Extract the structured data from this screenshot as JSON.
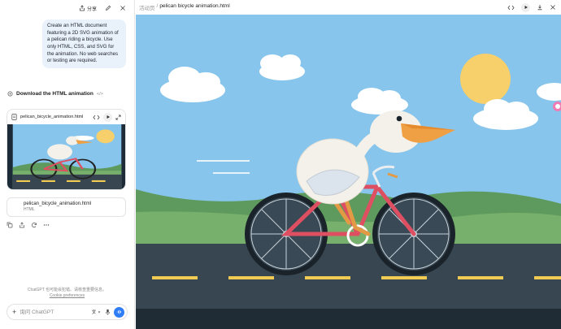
{
  "chat": {
    "topbar": {
      "share_label": "分享"
    },
    "user_message": "Create an HTML document featuring a 2D SVG animation of a pelican riding a bicycle. Use only HTML, CSS, and SVG for the animation. No web searches or testing are required.",
    "download_label": "Download the HTML animation",
    "code_tag": "</>",
    "preview_card": {
      "filename": "pelican_bicycle_animation.html"
    },
    "file_card": {
      "filename": "pelican_bicycle_animation.html",
      "filetype": "HTML"
    },
    "disclaimer": {
      "line1": "ChatGPT 也可能会犯错。请核查重要信息。",
      "link": "Cookie preferences"
    },
    "composer": {
      "placeholder": "询问 ChatGPT"
    }
  },
  "canvas": {
    "breadcrumb_parent": "活动页",
    "breadcrumb_sep": "/",
    "breadcrumb_file": "pelican bicycle animation.html"
  },
  "colors": {
    "sky": "#87c5ec",
    "sun": "#f7cf6b",
    "hills_back": "#5e9a5d",
    "hills_front": "#77b06c",
    "road": "#374650",
    "road_line": "#f2cc52",
    "frame": "#de4f62",
    "beak": "#f0a044",
    "accent_blue": "#2f7df6"
  },
  "icons": [
    "share-icon",
    "edit-icon",
    "close-icon",
    "code-icon",
    "play-icon",
    "download-icon",
    "expand-icon",
    "file-icon",
    "copy-icon",
    "speaker-icon",
    "refresh-icon",
    "more-icon",
    "plus-icon",
    "translate-icon",
    "mic-icon",
    "voice-icon"
  ]
}
